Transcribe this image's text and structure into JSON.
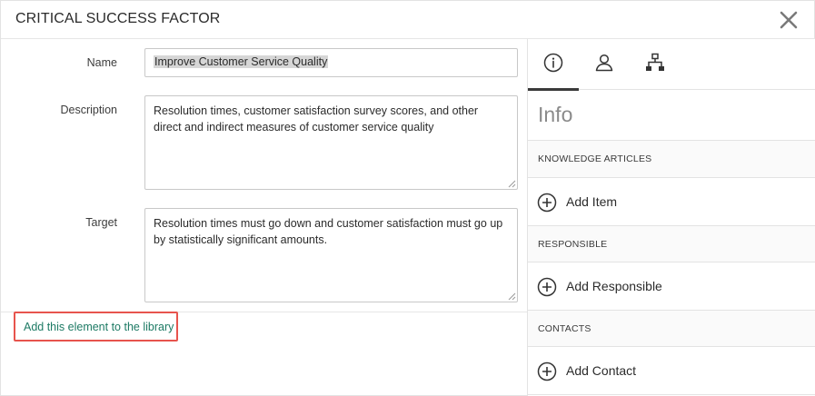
{
  "dialog": {
    "title": "CRITICAL SUCCESS FACTOR"
  },
  "form": {
    "name_label": "Name",
    "name_value": "Improve Customer Service Quality",
    "description_label": "Description",
    "description_value": "Resolution times, customer satisfaction survey scores, and other direct and indirect measures of customer service quality",
    "target_label": "Target",
    "target_value": "Resolution times must go down and customer satisfaction must go up by statistically significant amounts."
  },
  "library_link": "Add this element to the library",
  "side_panel": {
    "tabs": [
      {
        "icon": "info-icon",
        "active": true
      },
      {
        "icon": "person-icon",
        "active": false
      },
      {
        "icon": "hierarchy-icon",
        "active": false
      }
    ],
    "info_title": "Info",
    "sections": [
      {
        "header": "KNOWLEDGE ARTICLES",
        "action": "Add Item"
      },
      {
        "header": "RESPONSIBLE",
        "action": "Add Responsible"
      },
      {
        "header": "CONTACTS",
        "action": "Add Contact"
      }
    ]
  },
  "colors": {
    "link": "#1d7a64",
    "highlight_border": "#e7544d",
    "muted_title": "#8a8a8a"
  }
}
